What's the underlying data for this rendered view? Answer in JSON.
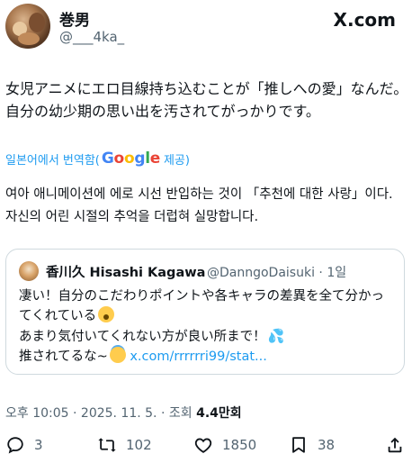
{
  "header": {
    "display_name": "巻男",
    "handle": "@___4ka_",
    "logo_text": "X.com"
  },
  "tweet": {
    "line1": "女児アニメにエロ目線持ち込むことが「推しへの愛」なんだ。",
    "line2": "自分の幼少期の思い出を汚されてがっかりです。"
  },
  "translation": {
    "prefix": "일본어에서 번역함(",
    "google": "Google",
    "suffix": " 제공)",
    "line1": "여아 애니메이션에 에로 시선 반입하는 것이 「추천에 대한 사랑」이다.",
    "line2": "자신의 어린 시절의 추억을 더럽혀 실망합니다."
  },
  "quote": {
    "display_name": "香川久 Hisashi Kagawa",
    "handle_time": "@DanngoDaisuki · 1일",
    "line1": "凄い！自分のこだわりポイントや各キャラの差異を全て分かっ",
    "line2": "てくれている",
    "line3": "あまり気付いてくれない方が良い所まで！",
    "line4": "推されてるな~",
    "link": "x.com/rrrrrri99/stat..."
  },
  "meta": {
    "time_date": "오후 10:05 · 2025. 11. 5. · 조회 ",
    "views": "4.4만회"
  },
  "actions": {
    "replies": "3",
    "reposts": "102",
    "likes": "1850",
    "bookmarks": "38"
  },
  "colors": {
    "link": "#1d9bf0",
    "secondary_text": "#536471",
    "border": "#cfd9de"
  }
}
